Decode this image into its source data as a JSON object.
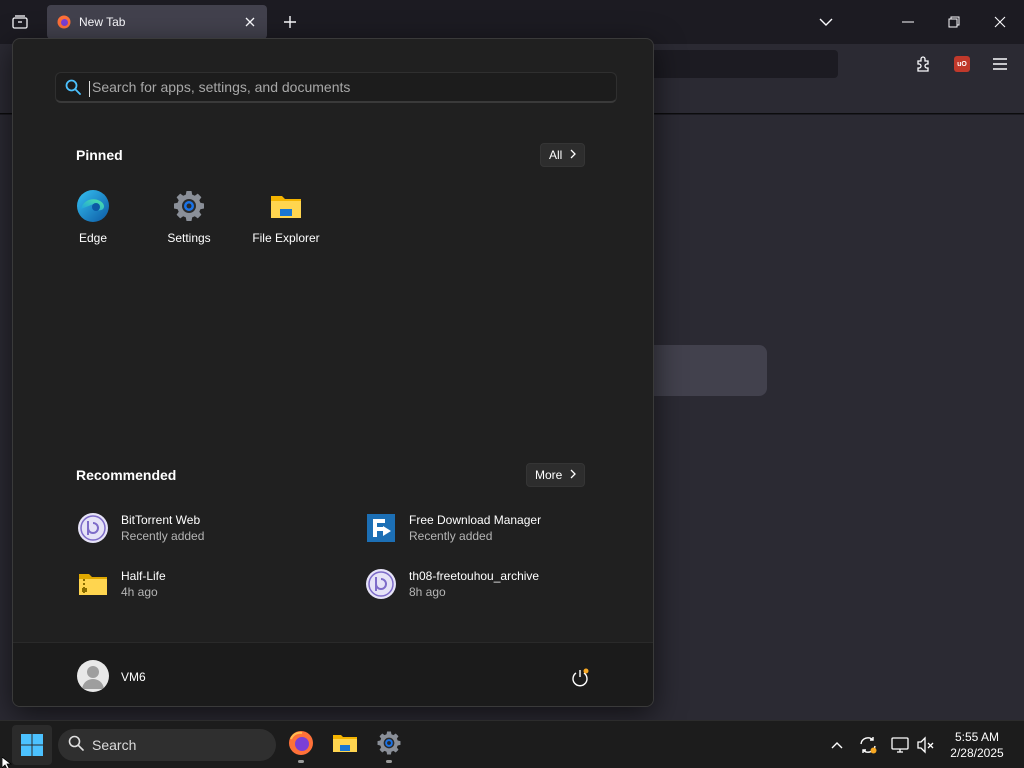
{
  "browser": {
    "tab_title": "New Tab"
  },
  "start_menu": {
    "search_placeholder": "Search for apps, settings, and documents",
    "pinned_title": "Pinned",
    "all_label": "All",
    "pinned_apps": [
      {
        "label": "Edge",
        "icon": "edge-icon"
      },
      {
        "label": "Settings",
        "icon": "settings-gear-icon"
      },
      {
        "label": "File Explorer",
        "icon": "folder-icon"
      }
    ],
    "recommended_title": "Recommended",
    "more_label": "More",
    "recommended": [
      {
        "name": "BitTorrent Web",
        "sub": "Recently added",
        "icon": "bittorrent-icon"
      },
      {
        "name": "Free Download Manager",
        "sub": "Recently added",
        "icon": "fdm-icon"
      },
      {
        "name": "Half-Life",
        "sub": "4h ago",
        "icon": "zip-folder-icon"
      },
      {
        "name": "th08-freetouhou_archive",
        "sub": "8h ago",
        "icon": "bittorrent-icon"
      }
    ],
    "user_name": "VM6"
  },
  "taskbar": {
    "search_label": "Search",
    "time": "5:55 AM",
    "date": "2/28/2025"
  },
  "colors": {
    "accent": "#4cc2ff",
    "start_bg": "#202020",
    "taskbar_bg": "#1c1c1c"
  }
}
